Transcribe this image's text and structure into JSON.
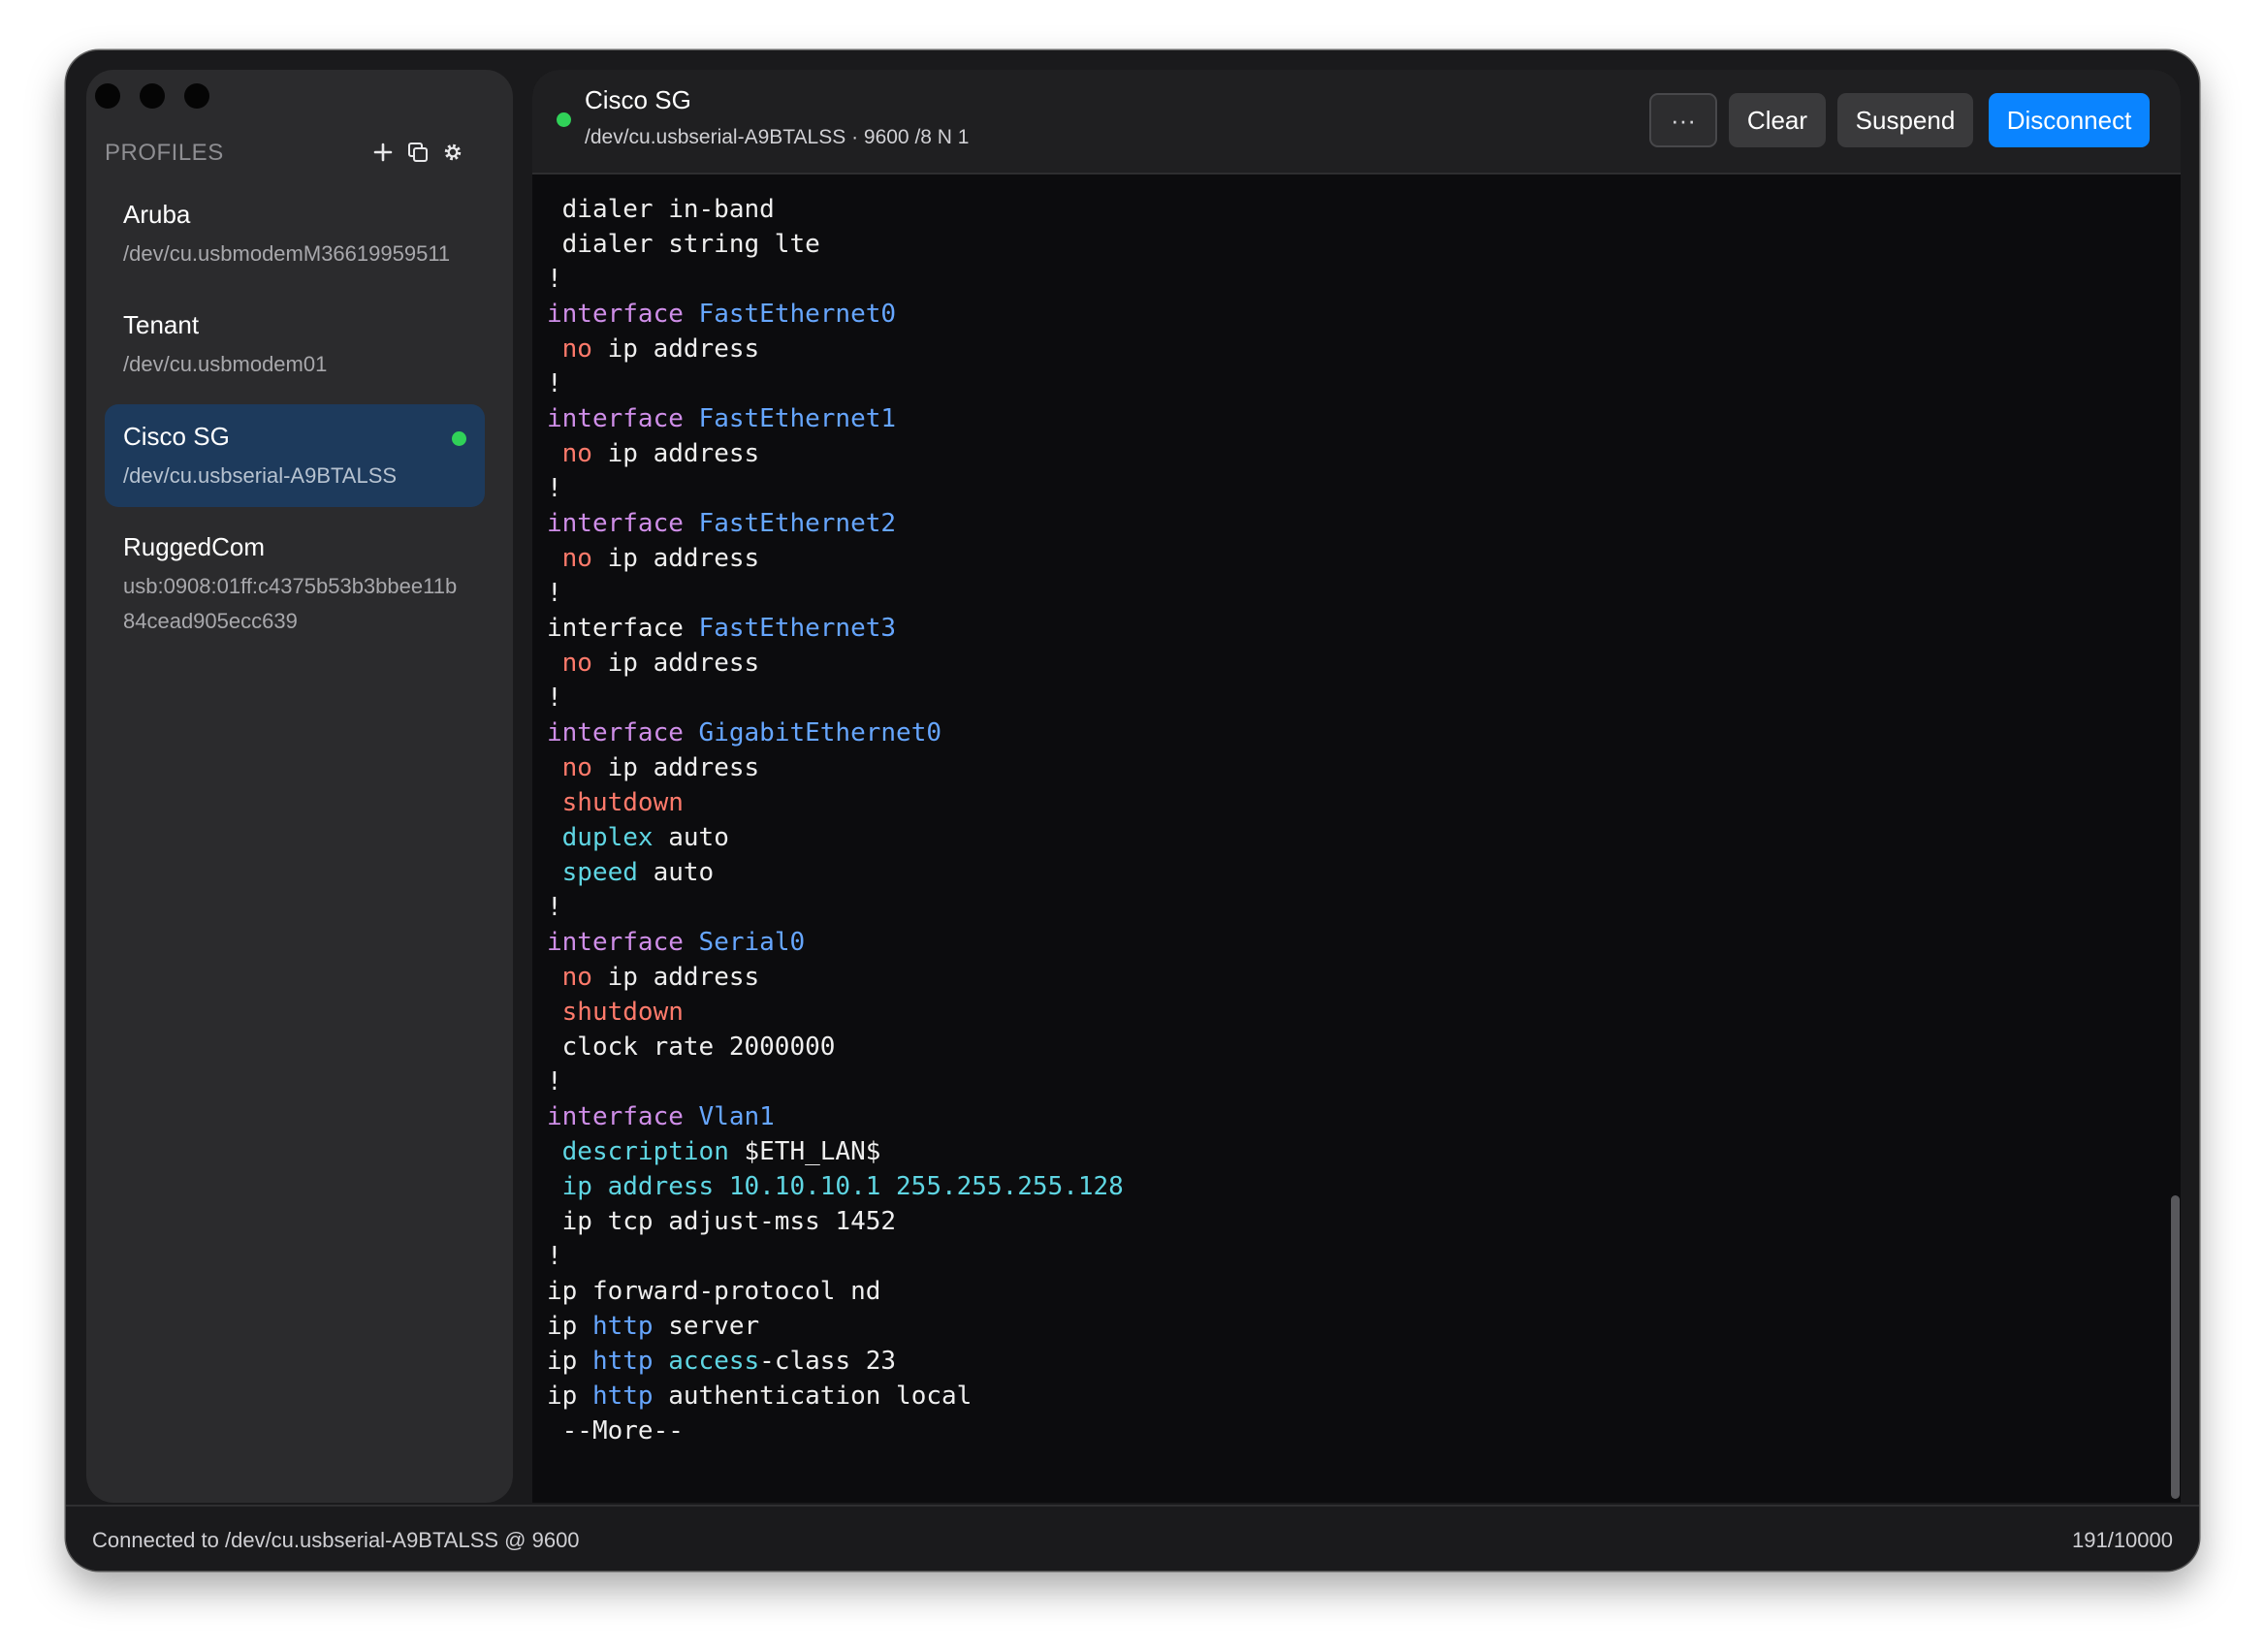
{
  "sidebar": {
    "title": "PROFILES",
    "icons": [
      "plus-icon",
      "copy-icon",
      "gear-icon"
    ],
    "items": [
      {
        "name": "Aruba",
        "path": "/dev/cu.usbmodemM36619959511",
        "active": false,
        "connected": false
      },
      {
        "name": "Tenant",
        "path": "/dev/cu.usbmodem01",
        "active": false,
        "connected": false
      },
      {
        "name": "Cisco SG",
        "path": "/dev/cu.usbserial-A9BTALSS",
        "active": true,
        "connected": true
      },
      {
        "name": "RuggedCom",
        "path": "usb:0908:01ff:c4375b53b3bbee11b84cead905ecc639",
        "active": false,
        "connected": false
      }
    ]
  },
  "header": {
    "title": "Cisco SG",
    "subtitle": "/dev/cu.usbserial-A9BTALSS · 9600 /8 N 1",
    "more_label": "···",
    "clear_label": "Clear",
    "suspend_label": "Suspend",
    "disconnect_label": "Disconnect"
  },
  "colors": {
    "connected": "#30d158",
    "accent": "#0a84ff",
    "keyword": "#cf8ee8",
    "value": "#66a6ff",
    "negation": "#ff7a6b",
    "attribute": "#5fd6e3"
  },
  "terminal": {
    "lines": [
      [
        {
          "t": " dialer in-band",
          "c": "text"
        }
      ],
      [
        {
          "t": " dialer string lte",
          "c": "text"
        }
      ],
      [
        {
          "t": "!",
          "c": "text"
        }
      ],
      [
        {
          "t": "interface",
          "c": "kw"
        },
        {
          "t": " ",
          "c": "text"
        },
        {
          "t": "FastEthernet0",
          "c": "val"
        }
      ],
      [
        {
          "t": " ",
          "c": "text"
        },
        {
          "t": "no",
          "c": "neg"
        },
        {
          "t": " ip address",
          "c": "text"
        }
      ],
      [
        {
          "t": "!",
          "c": "text"
        }
      ],
      [
        {
          "t": "interface",
          "c": "kw"
        },
        {
          "t": " ",
          "c": "text"
        },
        {
          "t": "FastEthernet1",
          "c": "val"
        }
      ],
      [
        {
          "t": " ",
          "c": "text"
        },
        {
          "t": "no",
          "c": "neg"
        },
        {
          "t": " ip address",
          "c": "text"
        }
      ],
      [
        {
          "t": "!",
          "c": "text"
        }
      ],
      [
        {
          "t": "interface",
          "c": "kw"
        },
        {
          "t": " ",
          "c": "text"
        },
        {
          "t": "FastEthernet2",
          "c": "val"
        }
      ],
      [
        {
          "t": " ",
          "c": "text"
        },
        {
          "t": "no",
          "c": "neg"
        },
        {
          "t": " ip address",
          "c": "text"
        }
      ],
      [
        {
          "t": "!",
          "c": "text"
        }
      ],
      [
        {
          "t": "interface ",
          "c": "text"
        },
        {
          "t": "FastEthernet3",
          "c": "val"
        }
      ],
      [
        {
          "t": " ",
          "c": "text"
        },
        {
          "t": "no",
          "c": "neg"
        },
        {
          "t": " ip address",
          "c": "text"
        }
      ],
      [
        {
          "t": "!",
          "c": "text"
        }
      ],
      [
        {
          "t": "interface",
          "c": "kw"
        },
        {
          "t": " ",
          "c": "text"
        },
        {
          "t": "GigabitEthernet0",
          "c": "val"
        }
      ],
      [
        {
          "t": " ",
          "c": "text"
        },
        {
          "t": "no",
          "c": "neg"
        },
        {
          "t": " ip address",
          "c": "text"
        }
      ],
      [
        {
          "t": " ",
          "c": "text"
        },
        {
          "t": "shutdown",
          "c": "neg"
        }
      ],
      [
        {
          "t": " ",
          "c": "text"
        },
        {
          "t": "duplex",
          "c": "attr"
        },
        {
          "t": " auto",
          "c": "text"
        }
      ],
      [
        {
          "t": " ",
          "c": "text"
        },
        {
          "t": "speed",
          "c": "attr"
        },
        {
          "t": " auto",
          "c": "text"
        }
      ],
      [
        {
          "t": "!",
          "c": "text"
        }
      ],
      [
        {
          "t": "interface",
          "c": "kw"
        },
        {
          "t": " ",
          "c": "text"
        },
        {
          "t": "Serial0",
          "c": "val"
        }
      ],
      [
        {
          "t": " ",
          "c": "text"
        },
        {
          "t": "no",
          "c": "neg"
        },
        {
          "t": " ip address",
          "c": "text"
        }
      ],
      [
        {
          "t": " ",
          "c": "text"
        },
        {
          "t": "shutdown",
          "c": "neg"
        }
      ],
      [
        {
          "t": " clock rate 2000000",
          "c": "text"
        }
      ],
      [
        {
          "t": "!",
          "c": "text"
        }
      ],
      [
        {
          "t": "interface",
          "c": "kw"
        },
        {
          "t": " ",
          "c": "text"
        },
        {
          "t": "Vlan1",
          "c": "val"
        }
      ],
      [
        {
          "t": " ",
          "c": "text"
        },
        {
          "t": "description",
          "c": "attr"
        },
        {
          "t": " $ETH_LAN$",
          "c": "text"
        }
      ],
      [
        {
          "t": " ",
          "c": "text"
        },
        {
          "t": "ip address 10.10.10.1 255.255.255.128",
          "c": "attr"
        }
      ],
      [
        {
          "t": " ip tcp adjust-mss 1452",
          "c": "text"
        }
      ],
      [
        {
          "t": "!",
          "c": "text"
        }
      ],
      [
        {
          "t": "ip forward-protocol nd",
          "c": "text"
        }
      ],
      [
        {
          "t": "ip ",
          "c": "text"
        },
        {
          "t": "http",
          "c": "val"
        },
        {
          "t": " server",
          "c": "text"
        }
      ],
      [
        {
          "t": "ip ",
          "c": "text"
        },
        {
          "t": "http",
          "c": "val"
        },
        {
          "t": " ",
          "c": "text"
        },
        {
          "t": "access",
          "c": "attr"
        },
        {
          "t": "-class 23",
          "c": "text"
        }
      ],
      [
        {
          "t": "ip ",
          "c": "text"
        },
        {
          "t": "http",
          "c": "val"
        },
        {
          "t": " authentication local",
          "c": "text"
        }
      ],
      [
        {
          "t": " --More--",
          "c": "text"
        }
      ]
    ]
  },
  "status": {
    "left": "Connected to /dev/cu.usbserial-A9BTALSS @ 9600",
    "right": "191/10000"
  }
}
